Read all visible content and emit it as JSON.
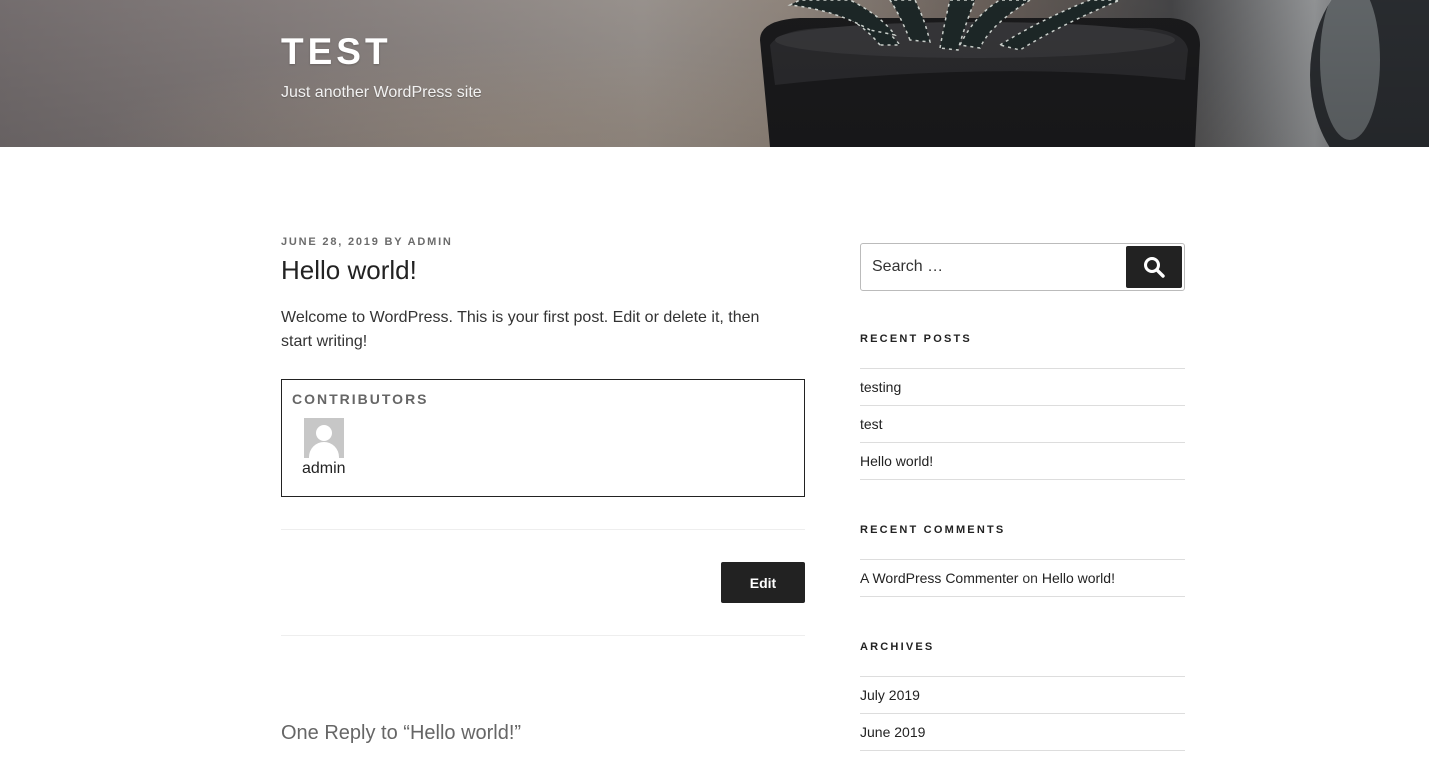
{
  "site": {
    "title": "TEST",
    "description": "Just another WordPress site"
  },
  "post": {
    "date": "JUNE 28, 2019",
    "by_label": "BY",
    "author": "ADMIN",
    "title": "Hello world!",
    "content": "Welcome to WordPress. This is your first post. Edit or delete it, then start writing!",
    "contributors": {
      "heading": "CONTRIBUTORS",
      "items": [
        {
          "name": "admin"
        }
      ]
    },
    "edit_label": "Edit"
  },
  "comments": {
    "title": "One Reply to “Hello world!”"
  },
  "sidebar": {
    "search": {
      "placeholder": "Search …",
      "icon": "search-icon"
    },
    "recent_posts": {
      "title": "RECENT POSTS",
      "items": [
        "testing",
        "test",
        "Hello world!"
      ]
    },
    "recent_comments": {
      "title": "RECENT COMMENTS",
      "items": [
        {
          "author": "A WordPress Commenter",
          "on": "on",
          "post": "Hello world!"
        }
      ]
    },
    "archives": {
      "title": "ARCHIVES",
      "items": [
        "July 2019",
        "June 2019"
      ]
    }
  },
  "colors": {
    "button_bg": "#222222",
    "meta_text": "#6b6b6b",
    "divider": "#dddddd"
  }
}
